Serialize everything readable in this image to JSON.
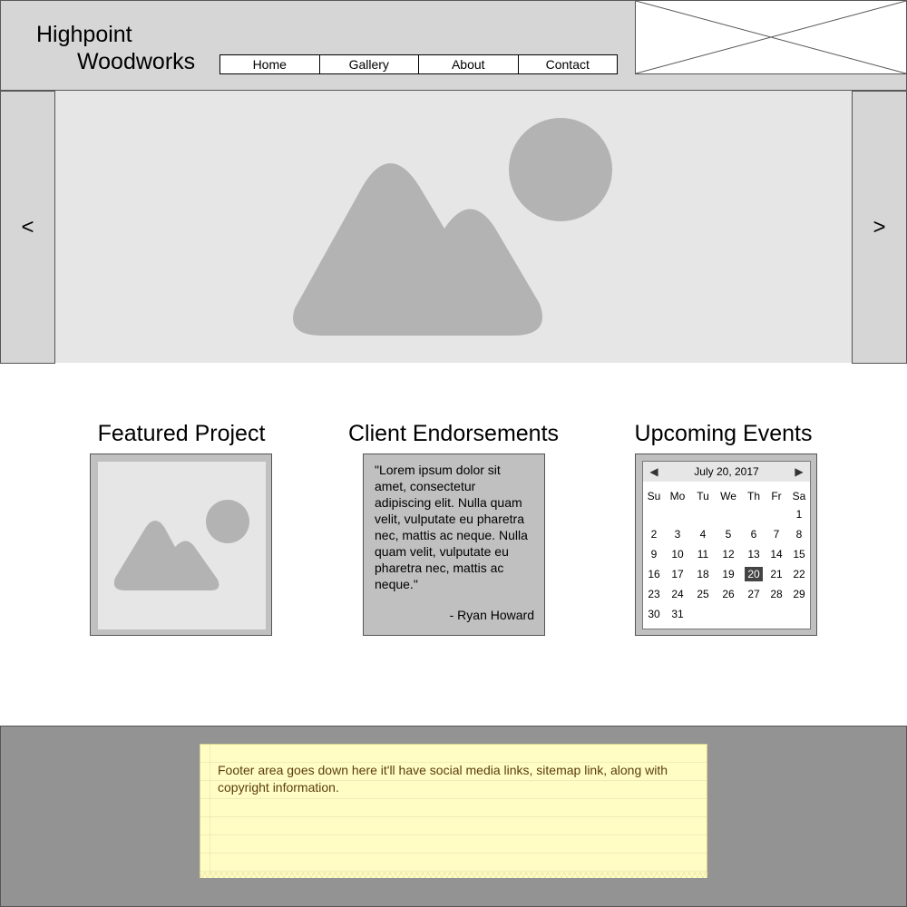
{
  "header": {
    "logo_line1": "Highpoint",
    "logo_line2": "Woodworks",
    "nav": [
      "Home",
      "Gallery",
      "About",
      "Contact"
    ]
  },
  "hero": {
    "prev_label": "<",
    "next_label": ">"
  },
  "sections": {
    "featured_title": "Featured Project",
    "endorsements_title": "Client Endorsements",
    "events_title": "Upcoming Events"
  },
  "endorsement": {
    "quote": "\"Lorem ipsum dolor sit amet, consectetur adipiscing elit. Nulla quam velit, vulputate eu pharetra nec, mattis ac neque. Nulla quam velit, vulputate eu pharetra nec, mattis ac neque.\"",
    "author": "- Ryan Howard"
  },
  "calendar": {
    "title": "July 20, 2017",
    "prev_icon": "triangle-left-icon",
    "next_icon": "triangle-right-icon",
    "weekdays": [
      "Su",
      "Mo",
      "Tu",
      "We",
      "Th",
      "Fr",
      "Sa"
    ],
    "weeks": [
      [
        "",
        "",
        "",
        "",
        "",
        "",
        "1"
      ],
      [
        "2",
        "3",
        "4",
        "5",
        "6",
        "7",
        "8"
      ],
      [
        "9",
        "10",
        "11",
        "12",
        "13",
        "14",
        "15"
      ],
      [
        "16",
        "17",
        "18",
        "19",
        "20",
        "21",
        "22"
      ],
      [
        "23",
        "24",
        "25",
        "26",
        "27",
        "28",
        "29"
      ],
      [
        "30",
        "31",
        "",
        "",
        "",
        "",
        ""
      ]
    ],
    "selected_day": "20"
  },
  "footer": {
    "note": "Footer area goes down here it'll have social media links, sitemap link, along with copyright information."
  },
  "colors": {
    "header_bg": "#d6d6d6",
    "hero_bg": "#e6e6e6",
    "image_shape": "#b3b3b3",
    "footer_bg": "#939393",
    "note_bg": "#fffdc4",
    "note_text": "#5a3d0a"
  }
}
